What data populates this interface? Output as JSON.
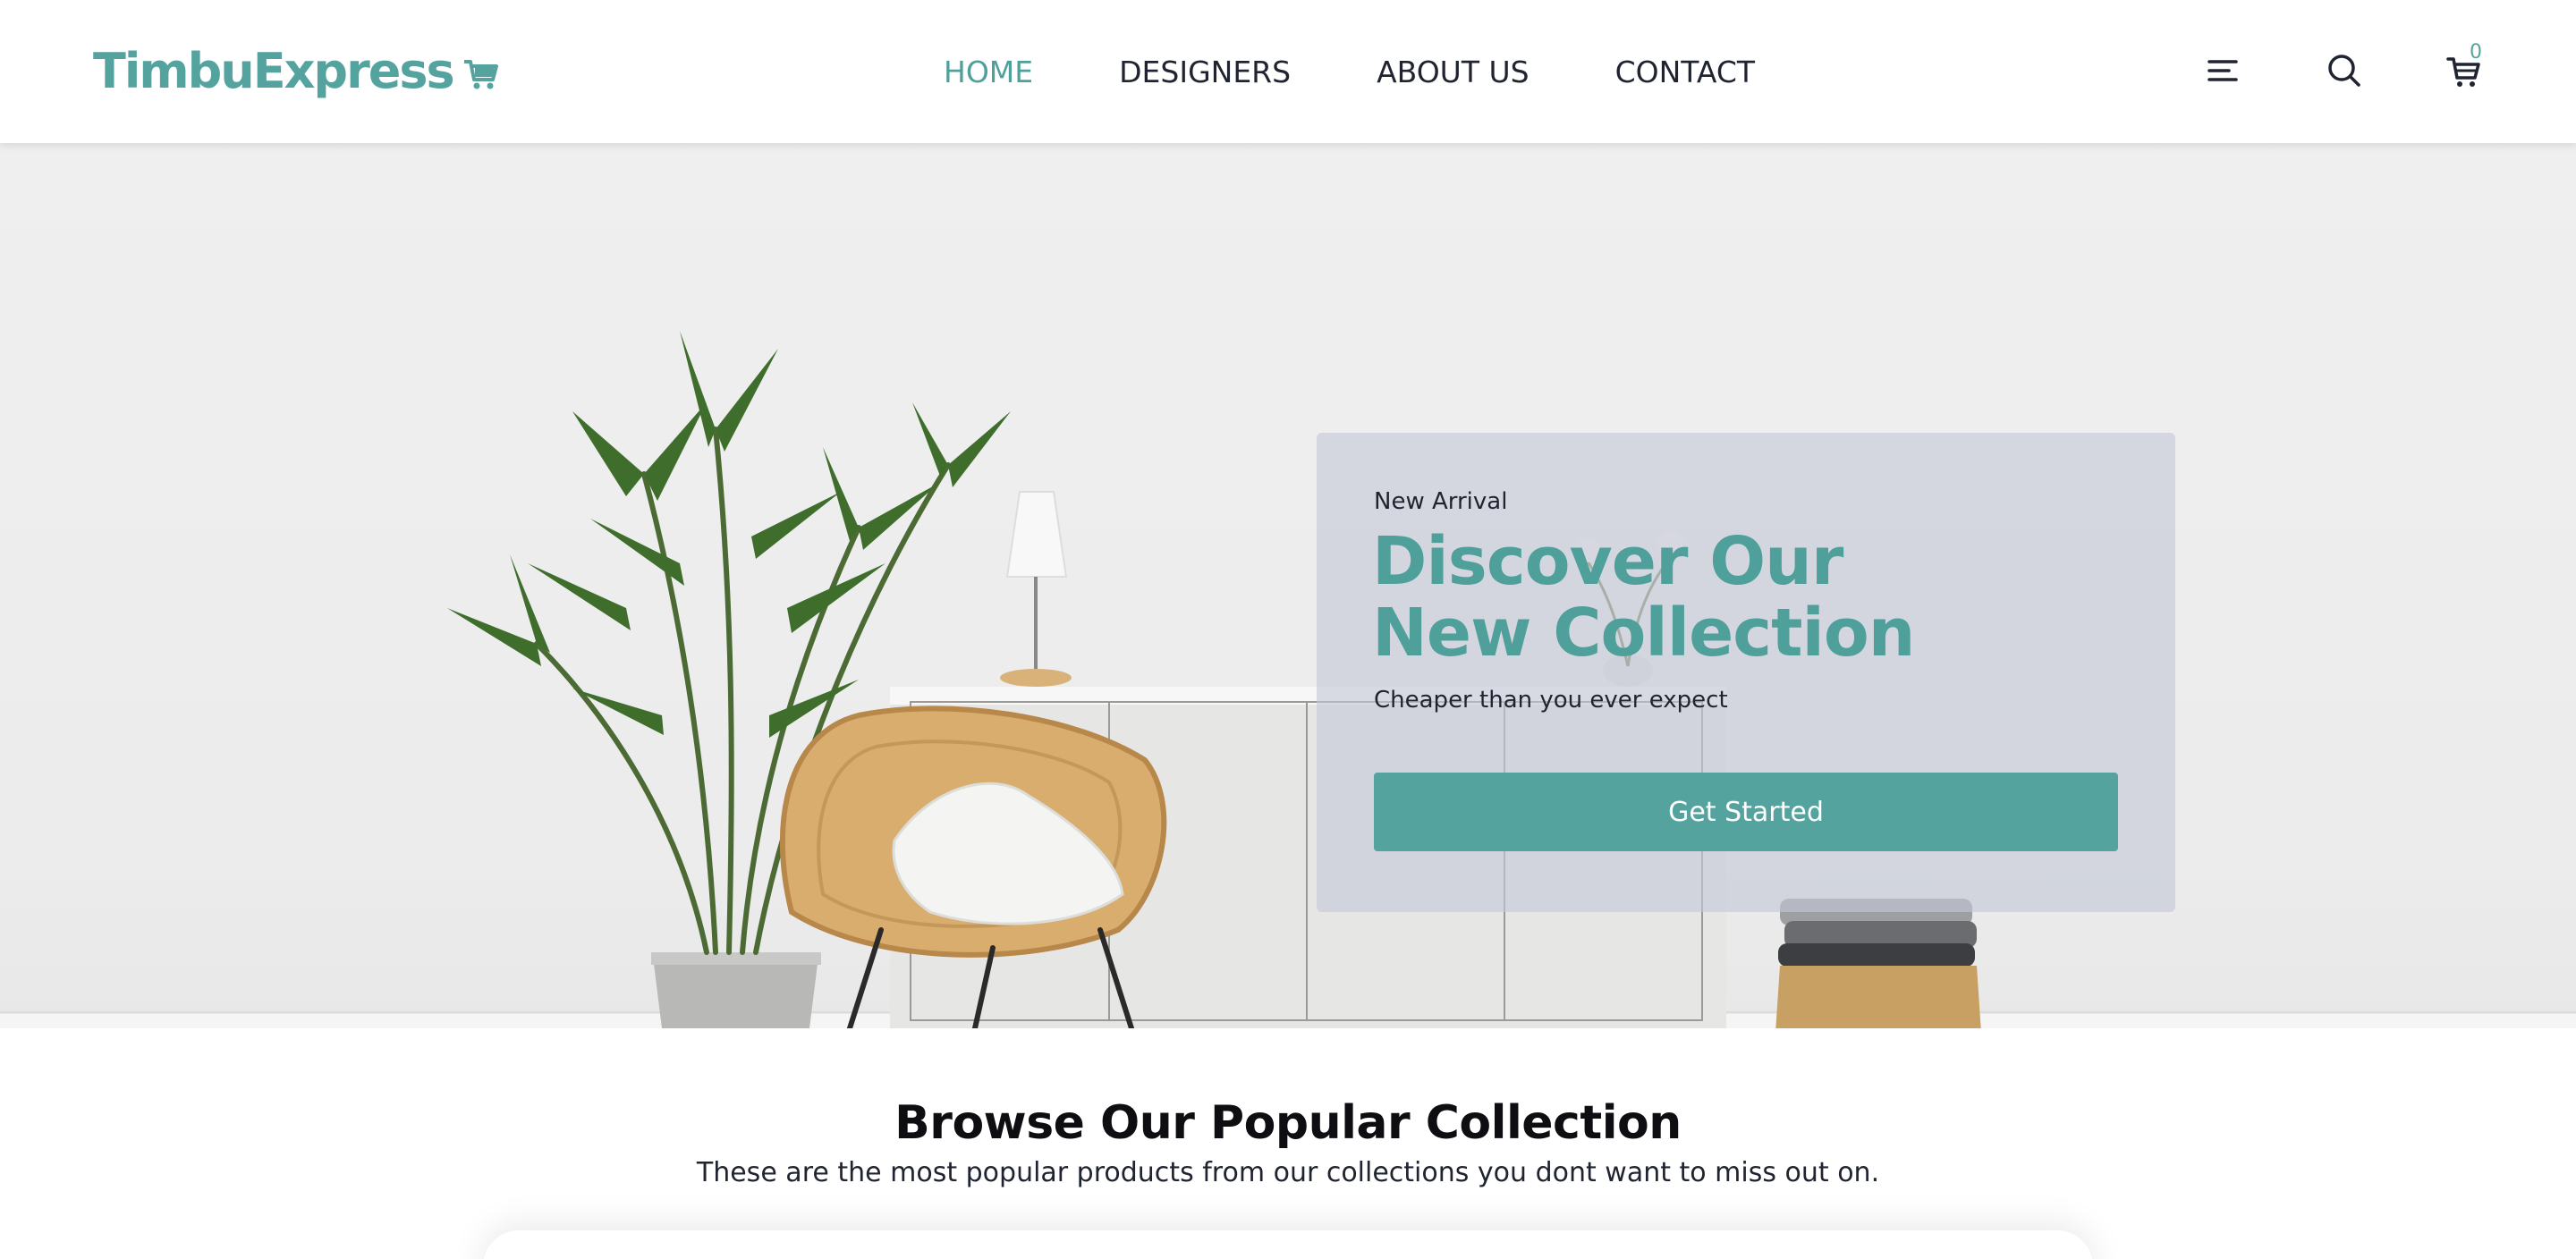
{
  "brand": {
    "name": "TimbuExpress",
    "icon": "shopping-cart-icon",
    "color": "#55a39e"
  },
  "nav": {
    "items": [
      {
        "label": "HOME",
        "active": true
      },
      {
        "label": "DESIGNERS",
        "active": false
      },
      {
        "label": "ABOUT US",
        "active": false
      },
      {
        "label": "CONTACT",
        "active": false
      }
    ]
  },
  "header_icons": {
    "menu": "menu-icon",
    "search": "search-icon",
    "cart": "cart-icon",
    "cart_count": "0"
  },
  "hero": {
    "eyebrow": "New Arrival",
    "title": "Discover Our New Collection",
    "subtitle": "Cheaper than you ever expect",
    "cta_label": "Get Started",
    "accent_color": "#4f9f9a"
  },
  "popular": {
    "title": "Browse Our Popular Collection",
    "subtitle": "These are the most popular products from our collections you dont want to miss out on."
  }
}
